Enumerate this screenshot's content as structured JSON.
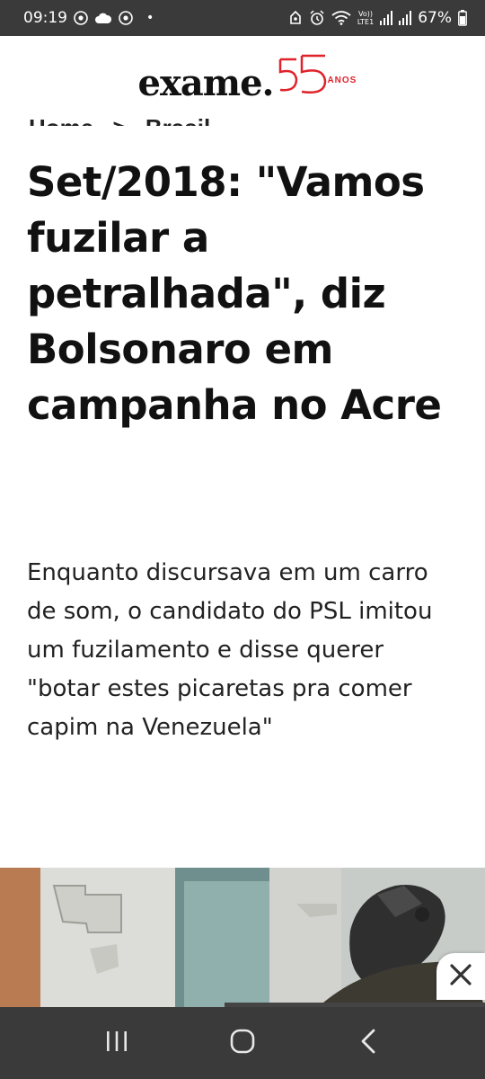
{
  "status_bar": {
    "time": "09:19",
    "dot": "•",
    "volte_top": "Vo))",
    "volte_bottom": "LTE1",
    "battery": "67%"
  },
  "header": {
    "logo_text": "exame.",
    "anniversary_number": "55",
    "anniversary_label": "ANOS",
    "accent_color": "#e0222a"
  },
  "breadcrumb": {
    "home": "Home",
    "separator": ">",
    "section": "Brasil"
  },
  "article": {
    "headline": "Set/2018: \"Vamos fuzilar a petralhada\", diz Bolsonaro em campanha no Acre",
    "subtitle": "Enquanto discursava em um carro de som, o candidato do PSL imitou um fuzilamento e disse querer \"botar estes picaretas pra comer capim na Venezuela\""
  },
  "icons": {
    "close": "close-icon",
    "recents": "recents-icon",
    "home": "home-icon",
    "back": "back-icon"
  }
}
